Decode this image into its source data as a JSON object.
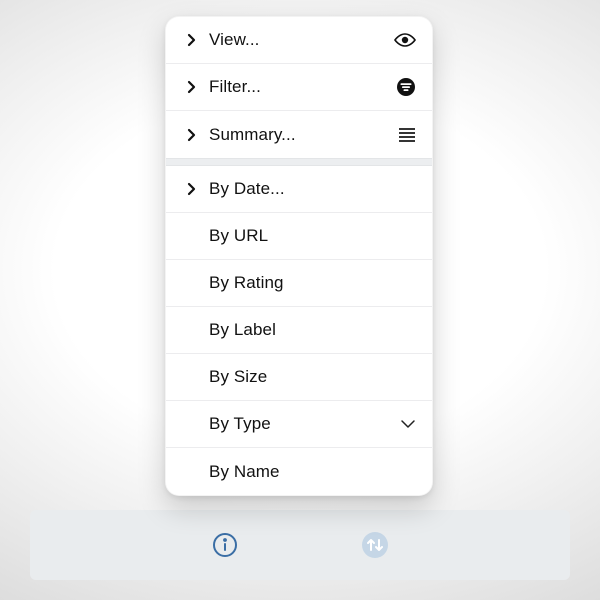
{
  "main_menu": {
    "items": [
      {
        "label": "View...",
        "icon": "eye-icon",
        "has_disclosure": true
      },
      {
        "label": "Filter...",
        "icon": "filter-icon",
        "has_disclosure": true
      },
      {
        "label": "Summary...",
        "icon": "summary-icon",
        "has_disclosure": true
      }
    ]
  },
  "sort_menu": {
    "items": [
      {
        "label": "By Date...",
        "has_disclosure": true,
        "trailing": null
      },
      {
        "label": "By URL",
        "has_disclosure": false,
        "trailing": null
      },
      {
        "label": "By Rating",
        "has_disclosure": false,
        "trailing": null
      },
      {
        "label": "By Label",
        "has_disclosure": false,
        "trailing": null
      },
      {
        "label": "By Size",
        "has_disclosure": false,
        "trailing": null
      },
      {
        "label": "By Type",
        "has_disclosure": false,
        "trailing": "chev-down"
      },
      {
        "label": "By Name",
        "has_disclosure": false,
        "trailing": null
      }
    ]
  },
  "toolbar": {
    "info_icon": "info-icon",
    "sort_icon": "sort-icon"
  }
}
